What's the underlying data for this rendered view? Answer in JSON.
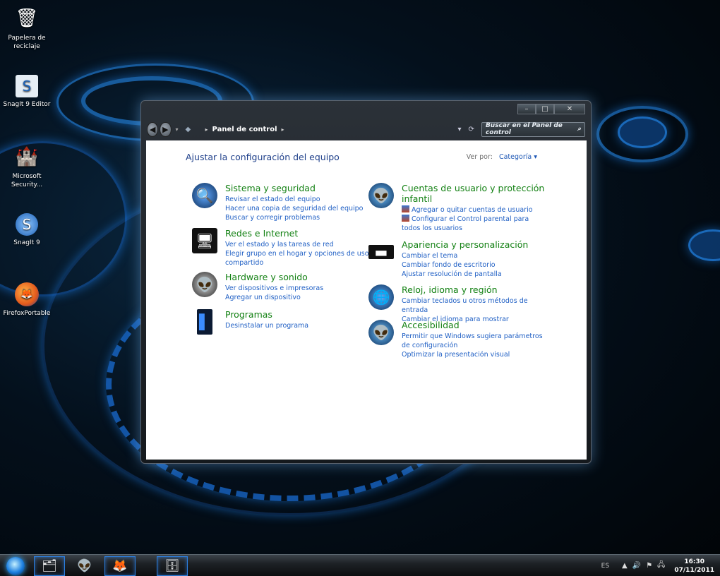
{
  "desktop": {
    "icons": [
      {
        "label": "Papelera de reciclaje",
        "icon": "recycle-bin-icon"
      },
      {
        "label": "SnagIt 9 Editor",
        "icon": "snagit-editor-icon"
      },
      {
        "label": "Microsoft Security...",
        "icon": "microsoft-security-icon"
      },
      {
        "label": "SnagIt 9",
        "icon": "snagit-icon"
      },
      {
        "label": "FirefoxPortable",
        "icon": "firefox-icon"
      }
    ]
  },
  "window": {
    "controls": {
      "minimize": "–",
      "maximize": "□",
      "close": "✕"
    },
    "address": {
      "root_icon": "◆",
      "location": "Panel de control"
    },
    "search_placeholder": "Buscar en el Panel de control",
    "title": "Ajustar la configuración del equipo",
    "view_by_label": "Ver por:",
    "view_by_value": "Categoría",
    "categories_left": [
      {
        "heading": "Sistema y seguridad",
        "icon": "system-security-icon",
        "links": [
          "Revisar el estado del equipo",
          "Hacer una copia de seguridad del equipo",
          "Buscar y corregir problemas"
        ]
      },
      {
        "heading": "Redes e Internet",
        "icon": "network-icon",
        "links": [
          "Ver el estado y las tareas de red",
          "Elegir grupo en el hogar y opciones de uso compartido"
        ]
      },
      {
        "heading": "Hardware y sonido",
        "icon": "hardware-sound-icon",
        "links": [
          "Ver dispositivos e impresoras",
          "Agregar un dispositivo"
        ]
      },
      {
        "heading": "Programas",
        "icon": "programs-icon",
        "links": [
          "Desinstalar un programa"
        ]
      }
    ],
    "categories_right": [
      {
        "heading": "Cuentas de usuario y protección infantil",
        "icon": "user-accounts-icon",
        "links": [
          "Agregar o quitar cuentas de usuario",
          "Configurar el Control parental para todos los usuarios"
        ]
      },
      {
        "heading": "Apariencia y personalización",
        "icon": "appearance-icon",
        "links": [
          "Cambiar el tema",
          "Cambiar fondo de escritorio",
          "Ajustar resolución de pantalla"
        ]
      },
      {
        "heading": "Reloj, idioma y región",
        "icon": "clock-region-icon",
        "links": [
          "Cambiar teclados u otros métodos de entrada",
          "Cambiar el idioma para mostrar"
        ]
      },
      {
        "heading": "Accesibilidad",
        "icon": "accessibility-icon",
        "links": [
          "Permitir que Windows sugiera parámetros de configuración",
          "Optimizar la presentación visual"
        ]
      }
    ]
  },
  "taskbar": {
    "language": "ES",
    "time": "16:30",
    "date": "07/11/2011"
  }
}
